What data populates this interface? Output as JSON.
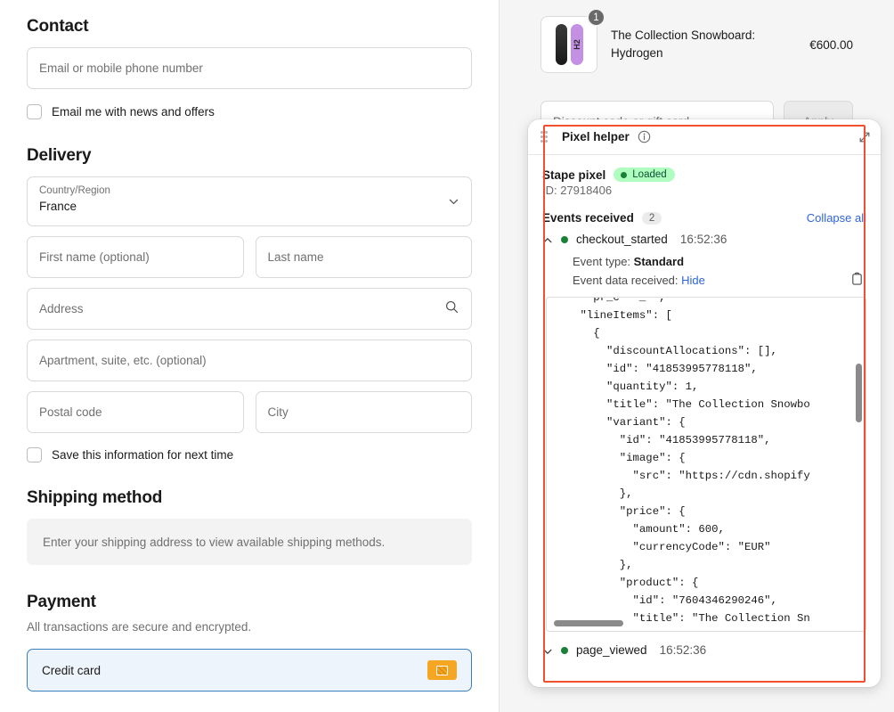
{
  "checkout": {
    "contact": {
      "title": "Contact",
      "email_placeholder": "Email or mobile phone number",
      "newsletter_label": "Email me with news and offers"
    },
    "delivery": {
      "title": "Delivery",
      "country_label": "Country/Region",
      "country_value": "France",
      "first_name_placeholder": "First name (optional)",
      "last_name_placeholder": "Last name",
      "address_placeholder": "Address",
      "apartment_placeholder": "Apartment, suite, etc. (optional)",
      "postal_code_placeholder": "Postal code",
      "city_placeholder": "City",
      "save_info_label": "Save this information for next time"
    },
    "shipping": {
      "title": "Shipping method",
      "notice": "Enter your shipping address to view available shipping methods."
    },
    "payment": {
      "title": "Payment",
      "subtitle": "All transactions are secure and encrypted.",
      "credit_card_label": "Credit card"
    }
  },
  "summary": {
    "line_item": {
      "title": "The Collection Snowboard: Hydrogen",
      "price": "€600.00",
      "quantity": "1",
      "thumb_text": "H2"
    },
    "discount_placeholder": "Discount code or gift card",
    "apply_label": "Apply"
  },
  "pixel_helper": {
    "title": "Pixel helper",
    "pixel_name": "Stape pixel",
    "status": "Loaded",
    "pixel_id": "ID: 27918406",
    "events_label": "Events received",
    "events_count": "2",
    "collapse_all": "Collapse all",
    "events": [
      {
        "name": "checkout_started",
        "time": "16:52:36",
        "event_type_label": "Event type:",
        "event_type_value": "Standard",
        "event_data_label": "Event data received:",
        "event_data_toggle": "Hide",
        "json": "      pr_c   _  ,\n    \"lineItems\": [\n      {\n        \"discountAllocations\": [],\n        \"id\": \"41853995778118\",\n        \"quantity\": 1,\n        \"title\": \"The Collection Snowbo\n        \"variant\": {\n          \"id\": \"41853995778118\",\n          \"image\": {\n            \"src\": \"https://cdn.shopify\n          },\n          \"price\": {\n            \"amount\": 600,\n            \"currencyCode\": \"EUR\"\n          },\n          \"product\": {\n            \"id\": \"7604346290246\",\n            \"title\": \"The Collection Sn"
      },
      {
        "name": "page_viewed",
        "time": "16:52:36"
      }
    ]
  },
  "colors": {
    "accent_blue": "#2f65d9",
    "highlight_orange": "#f0502d",
    "status_green_bg": "#affebf",
    "status_green_text": "#0c5132",
    "card_orange": "#f5a623"
  }
}
